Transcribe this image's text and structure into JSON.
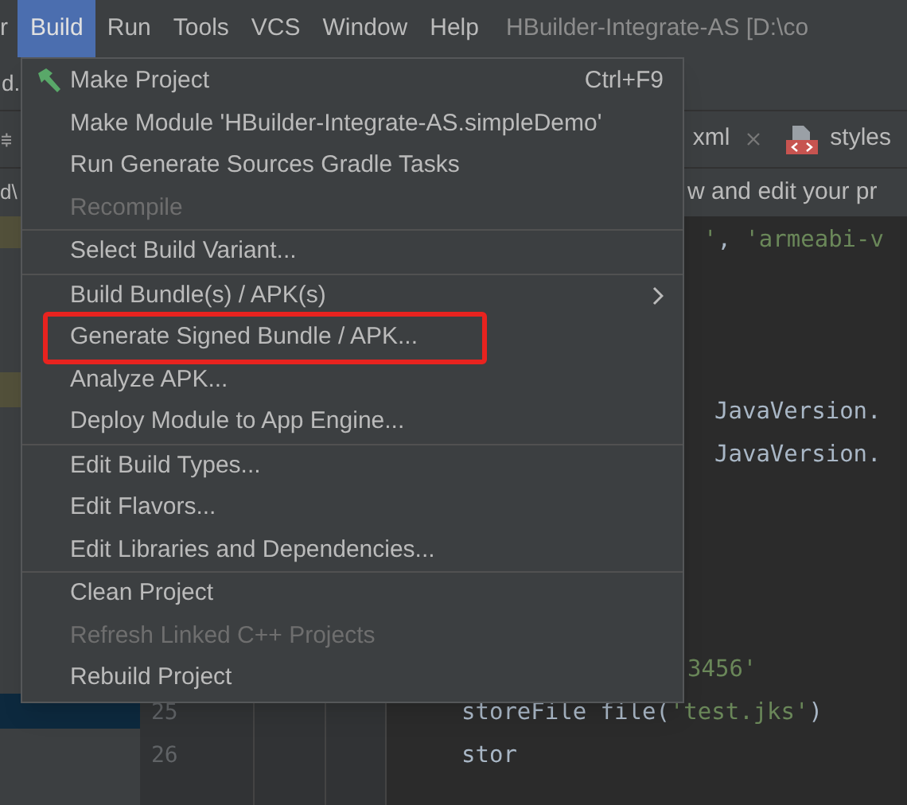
{
  "menubar": {
    "items": [
      {
        "label": "r",
        "selected": false
      },
      {
        "label": "Build",
        "selected": true
      },
      {
        "label": "Run",
        "selected": false
      },
      {
        "label": "Tools",
        "selected": false
      },
      {
        "label": "VCS",
        "selected": false
      },
      {
        "label": "Window",
        "selected": false
      },
      {
        "label": "Help",
        "selected": false
      }
    ],
    "title": "HBuilder-Integrate-AS [D:\\co"
  },
  "side_fragments": [
    "d.",
    "d\\"
  ],
  "editor_tabs": [
    {
      "label": "xml",
      "closable": true,
      "kind": "file"
    },
    {
      "label": "styles",
      "closable": false,
      "kind": "styles"
    }
  ],
  "notification": "w and edit your pr",
  "code_lines": [
    {
      "segments": [
        {
          "kind": "string",
          "text": "'"
        },
        {
          "kind": "plain",
          "text": ", "
        },
        {
          "kind": "string",
          "text": "'armeabi-v"
        }
      ]
    },
    {
      "segments": [
        {
          "kind": "plain",
          "text": "JavaVersion."
        }
      ]
    },
    {
      "segments": [
        {
          "kind": "plain",
          "text": "JavaVersion."
        }
      ]
    },
    {
      "segments": [
        {
          "kind": "string",
          "text": "3456'"
        }
      ]
    },
    {
      "number": "25",
      "segments": [
        {
          "kind": "plain",
          "text": "storeFile file("
        },
        {
          "kind": "string",
          "text": "'test.jks'"
        },
        {
          "kind": "plain",
          "text": ")"
        }
      ]
    },
    {
      "number": "26",
      "segments": [
        {
          "kind": "plain",
          "text": "stor"
        }
      ]
    }
  ],
  "menu": {
    "groups": [
      [
        {
          "label": "Make Project",
          "shortcut": "Ctrl+F9",
          "icon": true,
          "disabled": false,
          "submenu": false,
          "annotated": false
        },
        {
          "label": "Make Module 'HBuilder-Integrate-AS.simpleDemo'",
          "icon": false,
          "disabled": false,
          "submenu": false,
          "annotated": false
        },
        {
          "label": "Run Generate Sources Gradle Tasks",
          "icon": false,
          "disabled": false,
          "submenu": false,
          "annotated": false
        },
        {
          "label": "Recompile",
          "icon": false,
          "disabled": true,
          "submenu": false,
          "annotated": false
        }
      ],
      [
        {
          "label": "Select Build Variant...",
          "icon": false,
          "disabled": false,
          "submenu": false,
          "annotated": false
        }
      ],
      [
        {
          "label": "Build Bundle(s) / APK(s)",
          "icon": false,
          "disabled": false,
          "submenu": true,
          "annotated": false
        },
        {
          "label": "Generate Signed Bundle / APK...",
          "icon": false,
          "disabled": false,
          "submenu": false,
          "annotated": true
        },
        {
          "label": "Analyze APK...",
          "icon": false,
          "disabled": false,
          "submenu": false,
          "annotated": false
        },
        {
          "label": "Deploy Module to App Engine...",
          "icon": false,
          "disabled": false,
          "submenu": false,
          "annotated": false
        }
      ],
      [
        {
          "label": "Edit Build Types...",
          "icon": false,
          "disabled": false,
          "submenu": false,
          "annotated": false
        },
        {
          "label": "Edit Flavors...",
          "icon": false,
          "disabled": false,
          "submenu": false,
          "annotated": false
        },
        {
          "label": "Edit Libraries and Dependencies...",
          "icon": false,
          "disabled": false,
          "submenu": false,
          "annotated": false
        }
      ],
      [
        {
          "label": "Clean Project",
          "icon": false,
          "disabled": false,
          "submenu": false,
          "annotated": false
        },
        {
          "label": "Refresh Linked C++ Projects",
          "icon": false,
          "disabled": true,
          "submenu": false,
          "annotated": false
        },
        {
          "label": "Rebuild Project",
          "icon": false,
          "disabled": false,
          "submenu": false,
          "annotated": false
        }
      ]
    ]
  }
}
